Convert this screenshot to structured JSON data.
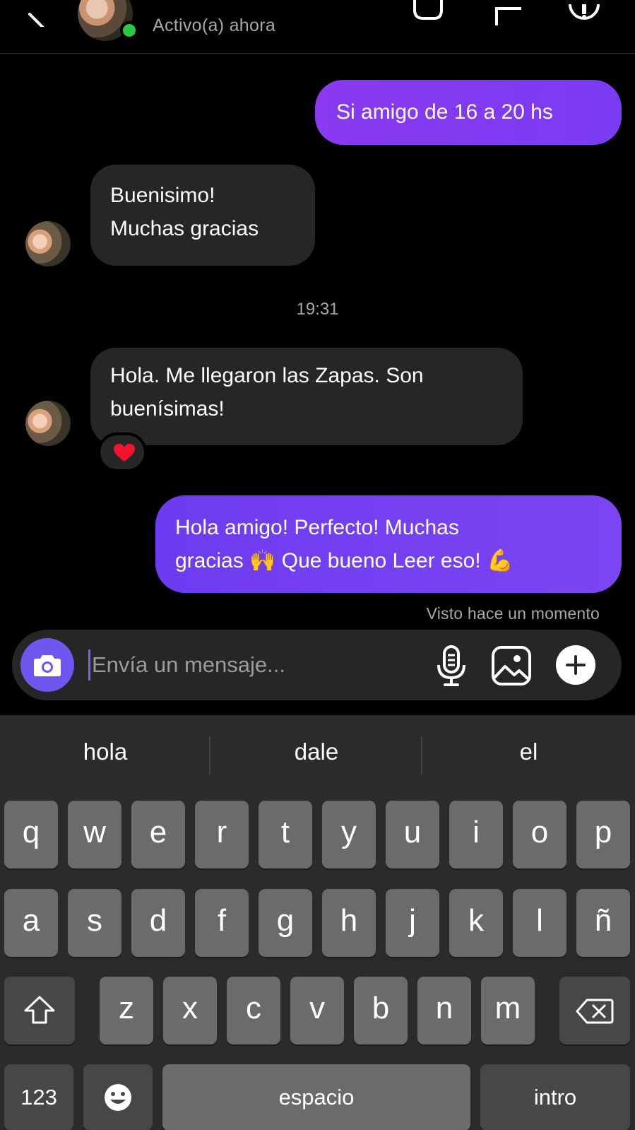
{
  "header": {
    "status": "Activo(a) ahora",
    "icons": [
      "back-icon",
      "video-call-icon",
      "flag-icon",
      "info-icon"
    ]
  },
  "messages": [
    {
      "direction": "outgoing",
      "text": "Si amigo de 16 a 20 hs"
    },
    {
      "direction": "incoming",
      "lines": [
        "Buenisimo!",
        "Muchas gracias"
      ]
    },
    {
      "direction": "incoming",
      "lines": [
        "Hola. Me llegaron las Zapas. Son",
        "buenísimas!"
      ],
      "reaction": "heart"
    },
    {
      "direction": "outgoing",
      "lines": [
        "Hola amigo! Perfecto! Muchas",
        "gracias 🙌 Que bueno Leer eso! 💪"
      ]
    }
  ],
  "timestamp": "19:31",
  "seen_status": "Visto hace un momento",
  "composer": {
    "placeholder": "Envía un mensaje...",
    "icons": [
      "camera-icon",
      "microphone-icon",
      "gallery-icon",
      "plus-icon"
    ]
  },
  "keyboard": {
    "suggestions": [
      "hola",
      "dale",
      "el"
    ],
    "row1": [
      "q",
      "w",
      "e",
      "r",
      "t",
      "y",
      "u",
      "i",
      "o",
      "p"
    ],
    "row2": [
      "a",
      "s",
      "d",
      "f",
      "g",
      "h",
      "j",
      "k",
      "l",
      "ñ"
    ],
    "row3": [
      "z",
      "x",
      "c",
      "v",
      "b",
      "n",
      "m"
    ],
    "numbers_label": "123",
    "space_label": "espacio",
    "return_label": "intro"
  },
  "colors": {
    "outgoing_bubble": "#7f3df1",
    "incoming_bubble": "#262626",
    "online": "#29c840",
    "camera_button": "#6e56ee"
  }
}
